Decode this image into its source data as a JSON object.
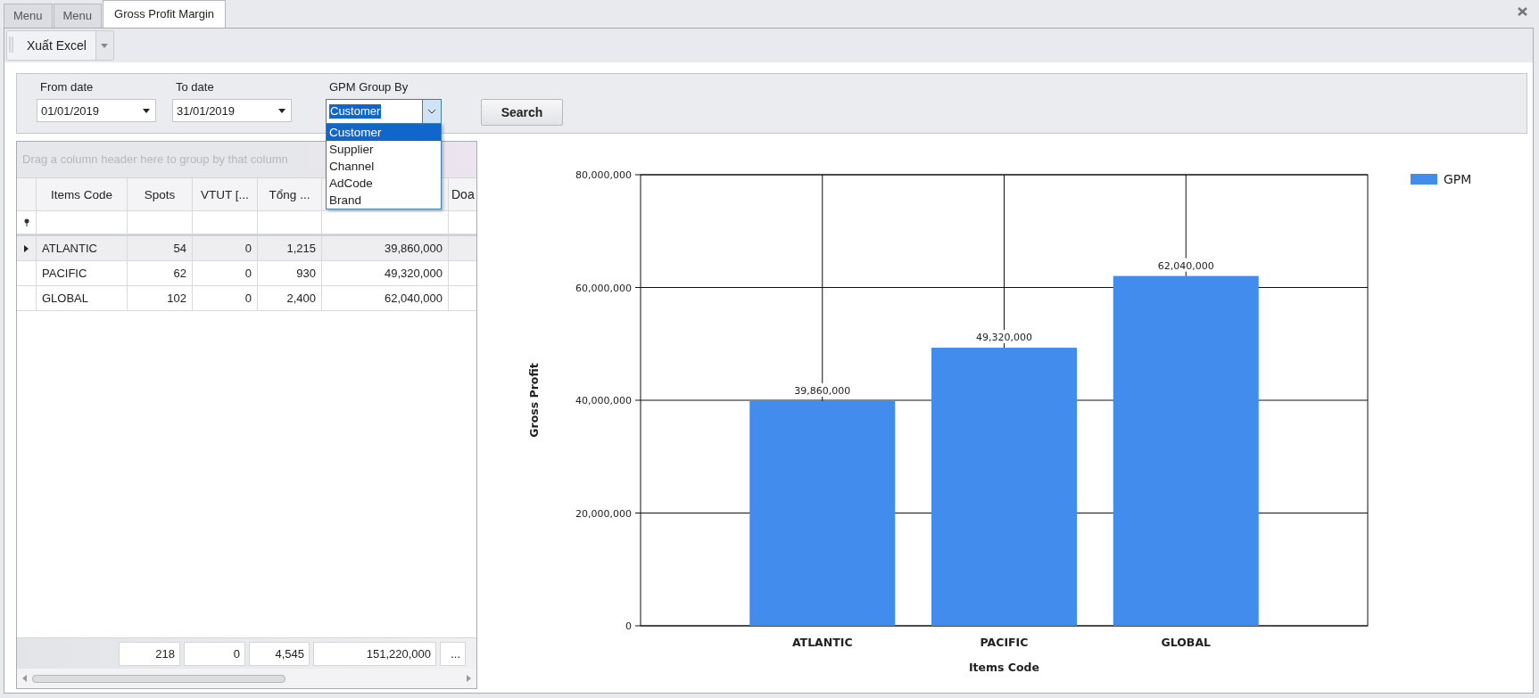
{
  "tabs": [
    {
      "label": "Menu",
      "selected": false
    },
    {
      "label": "Menu",
      "selected": false
    },
    {
      "label": "Gross Profit Margin",
      "selected": true
    }
  ],
  "toolbar": {
    "export_button": "Xuất Excel"
  },
  "filters": {
    "from_date": {
      "label": "From date",
      "value": "01/01/2019"
    },
    "to_date": {
      "label": "To date",
      "value": "31/01/2019"
    },
    "group_by": {
      "label": "GPM Group By",
      "value": "Customer",
      "options": [
        {
          "label": "Customer",
          "selected": true
        },
        {
          "label": "Supplier",
          "selected": false
        },
        {
          "label": "Channel",
          "selected": false
        },
        {
          "label": "AdCode",
          "selected": false
        },
        {
          "label": "Brand",
          "selected": false
        }
      ]
    },
    "search_button": "Search"
  },
  "grid": {
    "group_panel": "Drag a column header here to group by that column",
    "columns": [
      "Items Code",
      "Spots",
      "VTUT [...",
      "Tổng ...",
      "",
      "Doa"
    ],
    "rows": [
      {
        "cells": [
          "ATLANTIC",
          "54",
          "0",
          "1,215",
          "39,860,000",
          ""
        ],
        "selected": true
      },
      {
        "cells": [
          "PACIFIC",
          "62",
          "0",
          "930",
          "49,320,000",
          ""
        ],
        "selected": false
      },
      {
        "cells": [
          "GLOBAL",
          "102",
          "0",
          "2,400",
          "62,040,000",
          ""
        ],
        "selected": false
      }
    ],
    "totals": [
      "218",
      "0",
      "4,545",
      "151,220,000",
      "..."
    ]
  },
  "chart": {
    "chart_data": {
      "type": "bar",
      "xlabel": "Items Code",
      "ylabel": "Gross Profit",
      "categories": [
        "ATLANTIC",
        "PACIFIC",
        "GLOBAL"
      ],
      "series": [
        {
          "name": "GPM",
          "color": "#418ced",
          "values": [
            39860000,
            49320000,
            62040000
          ]
        }
      ],
      "ylim": [
        0,
        80000000
      ],
      "yticks": [
        {
          "value": 0,
          "label": "0"
        },
        {
          "value": 20000000,
          "label": "20,000,000"
        },
        {
          "value": 40000000,
          "label": "40,000,000"
        },
        {
          "value": 60000000,
          "label": "60,000,000"
        },
        {
          "value": 80000000,
          "label": "80,000,000"
        }
      ],
      "value_labels": [
        "39,860,000",
        "49,320,000",
        "62,040,000"
      ],
      "grid": true
    }
  }
}
